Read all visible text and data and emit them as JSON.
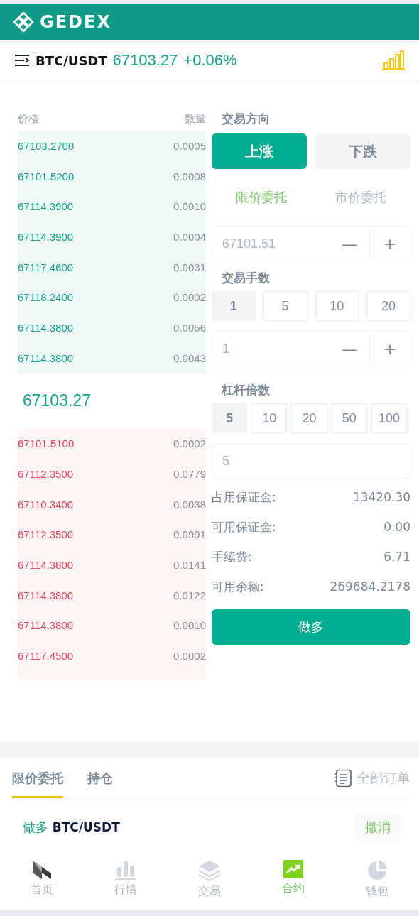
{
  "header": {
    "logo_text": "GEDEX",
    "pair": "BTC/USDT",
    "price": "67103.27",
    "change": "+0.06%"
  },
  "orderbook": {
    "columns": [
      "价格",
      "数量"
    ],
    "asks": [
      {
        "price": "67103.2700",
        "qty": "0.0005"
      },
      {
        "price": "67101.5200",
        "qty": "0.0008"
      },
      {
        "price": "67114.3900",
        "qty": "0.0010"
      },
      {
        "price": "67114.3900",
        "qty": "0.0004"
      },
      {
        "price": "67117.4600",
        "qty": "0.0031"
      },
      {
        "price": "67118.2400",
        "qty": "0.0002"
      },
      {
        "price": "67114.3800",
        "qty": "0.0056"
      },
      {
        "price": "67114.3800",
        "qty": "0.0043"
      }
    ],
    "mid_price": "67103.27",
    "bids": [
      {
        "price": "67101.5100",
        "qty": "0.0002"
      },
      {
        "price": "67112.3500",
        "qty": "0.0779"
      },
      {
        "price": "67110.3400",
        "qty": "0.0038"
      },
      {
        "price": "67112.3500",
        "qty": "0.0991"
      },
      {
        "price": "67114.3800",
        "qty": "0.0141"
      },
      {
        "price": "67114.3800",
        "qty": "0.0122"
      },
      {
        "price": "67114.3800",
        "qty": "0.0010"
      },
      {
        "price": "67117.4500",
        "qty": "0.0002"
      }
    ]
  },
  "trade": {
    "direction_title": "交易方向",
    "directions": [
      {
        "label": "上涨",
        "selected": true
      },
      {
        "label": "下跌",
        "selected": false
      }
    ],
    "order_types": [
      {
        "label": "限价委托",
        "selected": true
      },
      {
        "label": "市价委托",
        "selected": false
      }
    ],
    "price_field": {
      "placeholder": "67101.51",
      "minus": "—",
      "plus": "+"
    },
    "qty_title": "交易手数",
    "qty_presets": [
      {
        "label": "1",
        "selected": true
      },
      {
        "label": "5",
        "selected": false
      },
      {
        "label": "10",
        "selected": false
      },
      {
        "label": "20",
        "selected": false
      }
    ],
    "qty_field": {
      "value": "1",
      "minus": "—",
      "plus": "+"
    },
    "leverage_title": "杠杆倍数",
    "leverage_presets": [
      {
        "label": "5",
        "selected": true
      },
      {
        "label": "10",
        "selected": false
      },
      {
        "label": "20",
        "selected": false
      },
      {
        "label": "50",
        "selected": false
      },
      {
        "label": "100",
        "selected": false
      }
    ],
    "leverage_field": {
      "value": "5"
    },
    "info": [
      {
        "label": "占用保证金:",
        "value": "13420.30"
      },
      {
        "label": "可用保证金:",
        "value": "0.00"
      },
      {
        "label": "手续费:",
        "value": "6.71"
      },
      {
        "label": "可用余额:",
        "value": "269684.2178"
      }
    ],
    "submit": "做多"
  },
  "orders_section": {
    "tabs": [
      {
        "label": "限价委托",
        "selected": true
      },
      {
        "label": "持仓",
        "selected": false
      }
    ],
    "all_orders": "全部订单",
    "orders": [
      {
        "side": "做多",
        "pair": "BTC/USDT",
        "action": "撤消"
      }
    ]
  },
  "nav": [
    {
      "kind": "home",
      "label": "首页",
      "selected": false
    },
    {
      "kind": "market",
      "label": "行情",
      "selected": false
    },
    {
      "kind": "trade",
      "label": "交易",
      "selected": false
    },
    {
      "kind": "contract",
      "label": "合约",
      "selected": true
    },
    {
      "kind": "wallet",
      "label": "钱包",
      "selected": false
    }
  ]
}
